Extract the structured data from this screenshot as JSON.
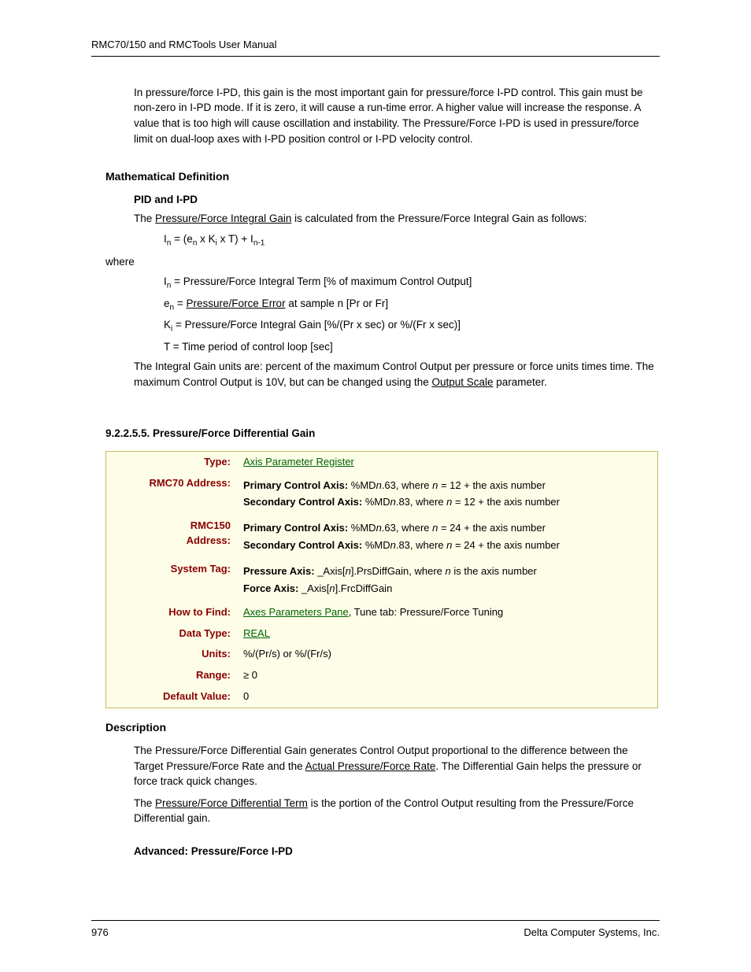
{
  "header": "RMC70/150 and RMCTools User Manual",
  "intro_para": "In pressure/force I-PD, this gain is the most important gain for pressure/force I-PD control. This gain must be non-zero in I-PD mode. If it is zero, it will cause a run-time error. A higher value will increase the response. A value that is too high will cause oscillation and instability. The Pressure/Force I-PD is used in pressure/force limit on dual-loop axes with I-PD position control or I-PD velocity control.",
  "mathdef": {
    "heading": "Mathematical Definition",
    "sub": "PID and I-PD",
    "intro_a": "The ",
    "intro_link": "Pressure/Force Integral Gain",
    "intro_b": " is calculated from the Pressure/Force Integral Gain as follows:",
    "formula_pre": "I",
    "formula_mid1": " = (e",
    "formula_mid2": " x K",
    "formula_mid3": " x T) + I",
    "where": "where",
    "def_In": " = Pressure/Force Integral Term [% of maximum Control Output]",
    "def_en_a": " = ",
    "def_en_link": "Pressure/Force Error",
    "def_en_b": " at sample n [Pr or Fr]",
    "def_Ki": " = Pressure/Force Integral Gain [%/(Pr x sec) or %/(Fr x sec)]",
    "def_T": "T = Time period of control loop [sec]",
    "tail_a": "The Integral Gain units are: percent of the maximum Control Output per pressure or force units times time. The maximum Control Output is 10V, but can be changed using the ",
    "tail_link": "Output Scale",
    "tail_b": " parameter."
  },
  "section_num": "9.2.2.5.5. Pressure/Force Differential Gain",
  "table": {
    "type_label": "Type:",
    "type_link": "Axis Parameter Register",
    "rmc70_label": "RMC70 Address:",
    "rmc70_p1a": "Primary Control Axis:",
    "rmc70_p1b": " %MD",
    "rmc70_p1c": ".63, where ",
    "rmc70_p1d": " = 12 + the axis number",
    "rmc70_s1a": "Secondary Control Axis:",
    "rmc70_s1b": " %MD",
    "rmc70_s1c": ".83, where ",
    "rmc70_s1d": " = 12 + the axis number",
    "rmc150_label_a": "RMC150",
    "rmc150_label_b": "Address:",
    "rmc150_p1a": "Primary Control Axis:",
    "rmc150_p1b": " %MD",
    "rmc150_p1c": ".63, where ",
    "rmc150_p1d": " = 24 + the axis number",
    "rmc150_s1a": "Secondary Control Axis:",
    "rmc150_s1b": " %MD",
    "rmc150_s1c": ".83, where ",
    "rmc150_s1d": " = 24 + the axis number",
    "systag_label": "System Tag:",
    "systag_p1a": "Pressure Axis:",
    "systag_p1b": " _Axis[",
    "systag_p1c": "].PrsDiffGain, where ",
    "systag_p1d": " is the axis number",
    "systag_f1a": "Force Axis:",
    "systag_f1b": " _Axis[",
    "systag_f1c": "].FrcDiffGain",
    "howto_label": "How to Find:",
    "howto_link": "Axes Parameters Pane",
    "howto_b": ", Tune tab: Pressure/Force Tuning",
    "datatype_label": "Data Type:",
    "datatype_link": "REAL",
    "units_label": "Units:",
    "units_val": "%/(Pr/s) or %/(Fr/s)",
    "range_label": "Range:",
    "range_val": "≥ 0",
    "default_label": "Default Value:",
    "default_val": "0",
    "n": "n"
  },
  "desc": {
    "heading": "Description",
    "p1a": "The Pressure/Force Differential Gain generates Control Output proportional to the difference between the Target Pressure/Force Rate and the ",
    "p1link": "Actual Pressure/Force Rate",
    "p1b": ". The Differential Gain helps the pressure or force track quick changes.",
    "p2a": "The ",
    "p2link": "Pressure/Force Differential Term",
    "p2b": " is the portion of the Control Output resulting from the Pressure/Force Differential gain.",
    "adv": "Advanced: Pressure/Force I-PD"
  },
  "footer": {
    "page": "976",
    "company": "Delta Computer Systems, Inc."
  }
}
